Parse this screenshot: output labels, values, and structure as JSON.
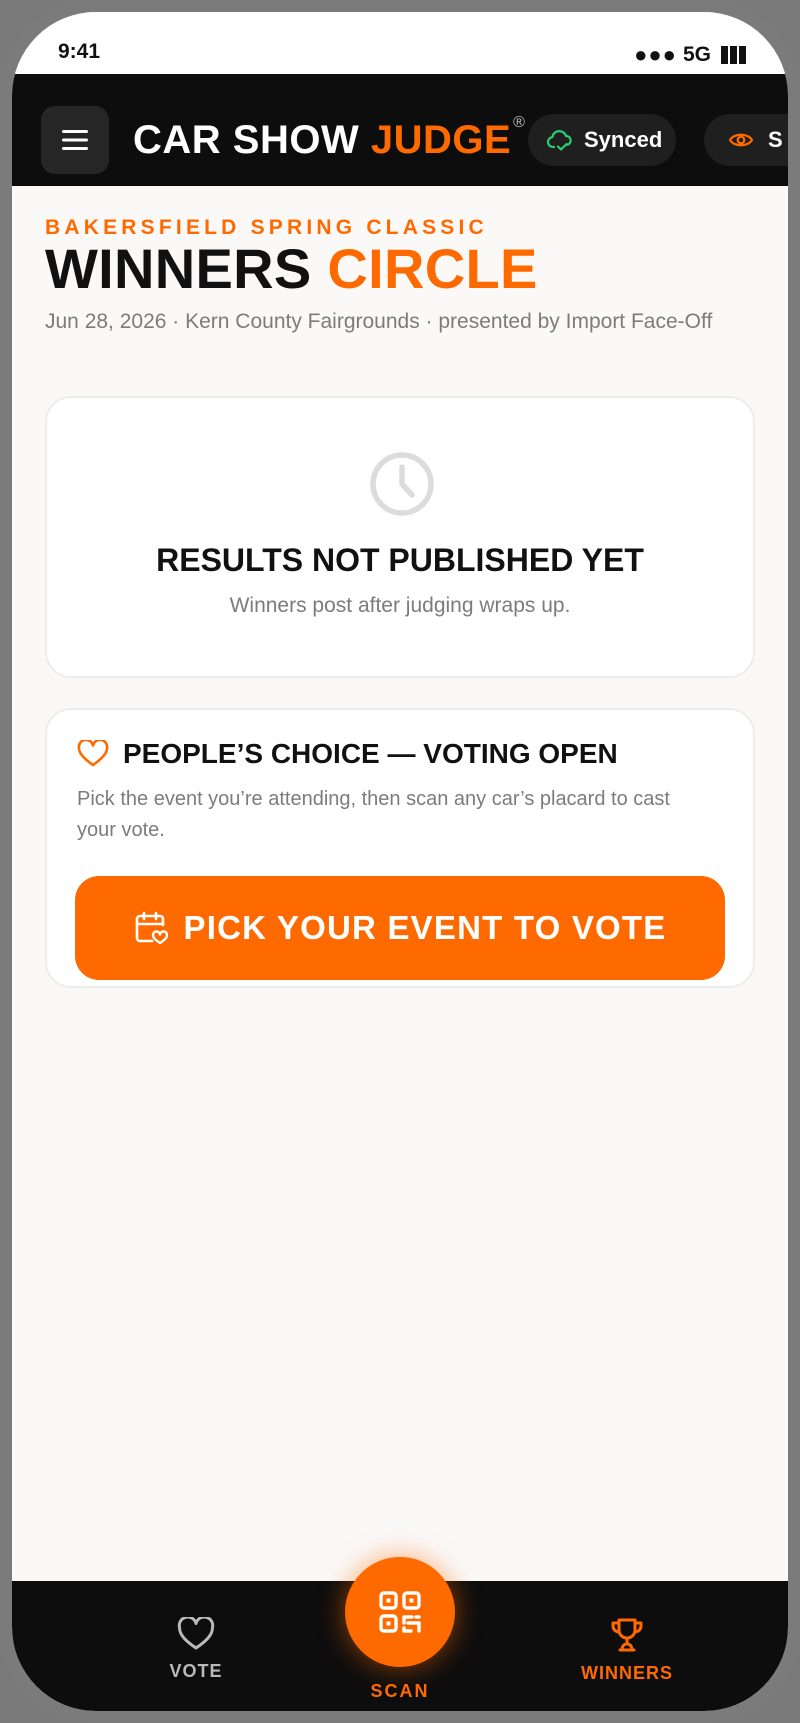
{
  "status_bar": {
    "time": "9:41",
    "signal": "●●●",
    "network": "5G"
  },
  "header": {
    "brand_part1": "CAR SHOW ",
    "brand_part2": "JUDGE",
    "brand_mark": "®",
    "sync_label": "Synced",
    "view_label": "S",
    "menu_icon": "hamburger-menu-icon",
    "sync_icon": "cloud-check-icon",
    "view_icon": "eye-icon"
  },
  "page": {
    "eyebrow": "BAKERSFIELD SPRING CLASSIC",
    "title_part1": "WINNERS ",
    "title_part2": "CIRCLE",
    "meta": "Jun 28, 2026 · Kern County Fairgrounds · presented by Import Face-Off"
  },
  "results_card": {
    "icon": "clock-icon",
    "title": "RESULTS NOT PUBLISHED YET",
    "subtitle": "Winners post after judging wraps up."
  },
  "vote_card": {
    "icon": "heart-icon",
    "title": "PEOPLE’S CHOICE — VOTING OPEN",
    "description": "Pick the event you’re attending, then scan any car’s placard to cast your vote.",
    "button_label": "PICK YOUR EVENT TO VOTE",
    "button_icon": "calendar-heart-icon"
  },
  "bottom_nav": {
    "vote_label": "VOTE",
    "scan_label": "SCAN",
    "winners_label": "WINNERS",
    "active": "WINNERS"
  },
  "colors": {
    "accent": "#ff6a00",
    "header_bg": "#0d0d0d",
    "sync_ok": "#2ecc71"
  }
}
